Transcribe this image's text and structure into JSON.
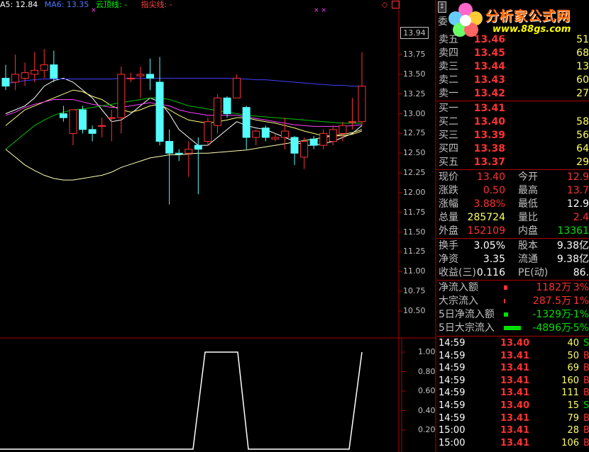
{
  "legend": {
    "ma5": "A5: 12.84",
    "ma6": "MA6: 13.35",
    "cloud": "云顶线: -",
    "tip": "指尖线: -",
    "marker1": "×",
    "marker2": "× ×",
    "marker3": "◇"
  },
  "colors": {
    "bg": "#000000",
    "up": "#ff3232",
    "down": "#54fcfc",
    "grid": "#b00000",
    "ma_white": "#ffffff",
    "ma_yellow": "#ffff80",
    "ma_magenta": "#ff40ff",
    "ma_green": "#00c000",
    "ma_blue": "#4040ff"
  },
  "price_axis": {
    "current_box": "13.94",
    "ticks": [
      "13.75",
      "13.50",
      "13.25",
      "13.00",
      "12.75",
      "12.50",
      "12.25",
      "12.00",
      "11.75",
      "11.50",
      "11.25",
      "11.00",
      "10.75",
      "10.50"
    ]
  },
  "indicator_axis": {
    "ticks": [
      "1.00",
      "0.80",
      "0.60",
      "0.40",
      "0.20"
    ]
  },
  "chart_data": {
    "type": "candlestick",
    "candles": [
      {
        "o": 13.45,
        "h": 13.62,
        "l": 13.3,
        "c": 13.35
      },
      {
        "o": 13.4,
        "h": 13.75,
        "l": 13.3,
        "c": 13.5
      },
      {
        "o": 13.45,
        "h": 13.65,
        "l": 13.35,
        "c": 13.52
      },
      {
        "o": 13.5,
        "h": 13.78,
        "l": 13.4,
        "c": 13.55
      },
      {
        "o": 13.55,
        "h": 13.82,
        "l": 13.45,
        "c": 13.62
      },
      {
        "o": 13.62,
        "h": 13.8,
        "l": 13.4,
        "c": 13.45
      },
      {
        "o": 13.0,
        "h": 13.1,
        "l": 12.9,
        "c": 12.95
      },
      {
        "o": 12.75,
        "h": 13.05,
        "l": 12.6,
        "c": 13.05
      },
      {
        "o": 13.05,
        "h": 13.1,
        "l": 12.75,
        "c": 12.8
      },
      {
        "o": 12.8,
        "h": 12.85,
        "l": 12.65,
        "c": 12.75
      },
      {
        "o": 12.85,
        "h": 12.95,
        "l": 12.7,
        "c": 12.85
      },
      {
        "o": 12.95,
        "h": 13.05,
        "l": 12.65,
        "c": 12.95
      },
      {
        "o": 12.95,
        "h": 13.6,
        "l": 12.75,
        "c": 13.5
      },
      {
        "o": 13.45,
        "h": 13.52,
        "l": 13.4,
        "c": 13.45
      },
      {
        "o": 13.48,
        "h": 13.6,
        "l": 13.2,
        "c": 13.5
      },
      {
        "o": 13.5,
        "h": 13.7,
        "l": 13.3,
        "c": 13.45
      },
      {
        "o": 13.4,
        "h": 13.72,
        "l": 12.6,
        "c": 12.65
      },
      {
        "o": 12.65,
        "h": 12.8,
        "l": 11.85,
        "c": 12.5
      },
      {
        "o": 12.5,
        "h": 12.55,
        "l": 12.4,
        "c": 12.49
      },
      {
        "o": 12.5,
        "h": 12.65,
        "l": 12.2,
        "c": 12.55
      },
      {
        "o": 12.6,
        "h": 12.7,
        "l": 11.98,
        "c": 12.55
      },
      {
        "o": 12.65,
        "h": 12.95,
        "l": 12.6,
        "c": 12.9
      },
      {
        "o": 12.85,
        "h": 13.25,
        "l": 12.75,
        "c": 13.2
      },
      {
        "o": 13.2,
        "h": 13.22,
        "l": 12.95,
        "c": 13.0
      },
      {
        "o": 13.2,
        "h": 13.5,
        "l": 13.2,
        "c": 13.45
      },
      {
        "o": 13.08,
        "h": 13.1,
        "l": 12.55,
        "c": 12.7
      },
      {
        "o": 12.7,
        "h": 12.8,
        "l": 12.6,
        "c": 12.78
      },
      {
        "o": 12.82,
        "h": 12.85,
        "l": 12.65,
        "c": 12.7
      },
      {
        "o": 12.68,
        "h": 12.75,
        "l": 12.65,
        "c": 12.7
      },
      {
        "o": 12.7,
        "h": 12.95,
        "l": 12.55,
        "c": 12.78
      },
      {
        "o": 12.7,
        "h": 12.72,
        "l": 12.35,
        "c": 12.5
      },
      {
        "o": 12.45,
        "h": 12.7,
        "l": 12.3,
        "c": 12.65
      },
      {
        "o": 12.68,
        "h": 12.72,
        "l": 12.55,
        "c": 12.6
      },
      {
        "o": 12.6,
        "h": 12.8,
        "l": 12.55,
        "c": 12.75
      },
      {
        "o": 12.65,
        "h": 12.85,
        "l": 12.6,
        "c": 12.8
      },
      {
        "o": 12.75,
        "h": 12.9,
        "l": 12.65,
        "c": 12.85
      },
      {
        "o": 12.9,
        "h": 13.2,
        "l": 12.8,
        "c": 12.9
      },
      {
        "o": 12.9,
        "h": 13.78,
        "l": 12.85,
        "c": 13.35
      }
    ],
    "ylim": [
      10.25,
      14.0
    ],
    "ma_lines": [
      {
        "name": "ma-white",
        "color": "#ffffff",
        "values": [
          13.0,
          13.05,
          13.1,
          13.2,
          13.35,
          13.42,
          13.45,
          13.4,
          13.3,
          13.2,
          13.05,
          12.9,
          12.92,
          13.0,
          13.1,
          13.2,
          13.15,
          13.0,
          12.8,
          12.7,
          12.6,
          12.6,
          12.7,
          12.8,
          12.9,
          12.85,
          12.82,
          12.8,
          12.75,
          12.7,
          12.65,
          12.6,
          12.6,
          12.62,
          12.65,
          12.7,
          12.75,
          12.85
        ]
      },
      {
        "name": "ma-yellow",
        "color": "#ffff80",
        "values": [
          12.85,
          12.95,
          13.05,
          13.1,
          13.15,
          13.2,
          13.25,
          13.3,
          13.28,
          13.22,
          13.18,
          13.1,
          13.05,
          13.02,
          13.05,
          13.1,
          13.12,
          13.05,
          12.98,
          12.92,
          12.9,
          12.88,
          12.9,
          12.92,
          12.95,
          12.95,
          12.92,
          12.9,
          12.88,
          12.85,
          12.82,
          12.78,
          12.75,
          12.72,
          12.72,
          12.72,
          12.74,
          12.78
        ]
      },
      {
        "name": "ma-magenta",
        "color": "#ff40ff",
        "values": [
          12.98,
          13.02,
          13.08,
          13.12,
          13.15,
          13.18,
          13.18,
          13.18,
          13.15,
          13.12,
          13.1,
          13.08,
          13.08,
          13.1,
          13.12,
          13.14,
          13.12,
          13.1,
          13.05,
          13.02,
          13.0,
          12.98,
          12.98,
          12.98,
          12.98,
          12.96,
          12.94,
          12.92,
          12.9,
          12.88,
          12.86,
          12.85,
          12.84,
          12.84,
          12.84,
          12.84,
          12.85,
          12.86
        ]
      },
      {
        "name": "ma-green",
        "color": "#00c000",
        "values": [
          12.55,
          12.65,
          12.75,
          12.85,
          12.92,
          12.98,
          13.02,
          13.05,
          13.06,
          13.08,
          13.1,
          13.12,
          13.14,
          13.16,
          13.18,
          13.2,
          13.2,
          13.18,
          13.14,
          13.1,
          13.08,
          13.06,
          13.04,
          13.02,
          13.0,
          12.98,
          12.97,
          12.96,
          12.95,
          12.94,
          12.93,
          12.92,
          12.91,
          12.9,
          12.89,
          12.88,
          12.88,
          12.88
        ]
      },
      {
        "name": "ma-blue",
        "color": "#4040ff",
        "values": [
          13.38,
          13.4,
          13.42,
          13.43,
          13.44,
          13.44,
          13.44,
          13.44,
          13.44,
          13.44,
          13.44,
          13.44,
          13.45,
          13.45,
          13.45,
          13.45,
          13.45,
          13.45,
          13.45,
          13.45,
          13.45,
          13.45,
          13.45,
          13.45,
          13.44,
          13.44,
          13.43,
          13.43,
          13.42,
          13.41,
          13.4,
          13.39,
          13.38,
          13.37,
          13.36,
          13.36,
          13.35,
          13.35
        ]
      },
      {
        "name": "ma-lower",
        "color": "#ffffb0",
        "values": [
          12.55,
          12.45,
          12.35,
          12.28,
          12.22,
          12.18,
          12.16,
          12.16,
          12.18,
          12.2,
          12.22,
          12.26,
          12.32,
          12.36,
          12.4,
          12.44,
          12.46,
          12.48,
          12.48,
          12.49,
          12.5,
          12.5,
          12.51,
          12.52,
          12.53,
          12.54,
          12.56,
          12.58,
          12.6,
          12.62,
          12.64,
          12.66,
          12.68,
          12.7,
          12.72,
          12.74,
          12.76,
          12.8
        ]
      }
    ],
    "indicator": [
      0,
      0,
      0,
      0,
      0,
      0,
      0,
      0,
      0,
      0,
      0,
      0,
      0,
      0,
      0,
      0,
      0,
      0,
      0,
      0,
      0,
      0,
      0,
      0,
      0,
      1,
      1,
      1,
      1,
      0,
      0,
      0,
      0,
      0,
      0,
      0,
      0,
      0,
      0,
      0,
      0,
      0,
      0,
      0,
      0,
      1
    ]
  },
  "panel": {
    "logo_text": "分析家公式网",
    "logo_url": "www.88gs.com",
    "top_label": "委",
    "sell": [
      {
        "label": "卖五",
        "price": "13.46",
        "vol": "51"
      },
      {
        "label": "卖四",
        "price": "13.45",
        "vol": "68"
      },
      {
        "label": "卖三",
        "price": "13.44",
        "vol": "13"
      },
      {
        "label": "卖二",
        "price": "13.43",
        "vol": "60"
      },
      {
        "label": "卖一",
        "price": "13.42",
        "vol": "27"
      }
    ],
    "buy": [
      {
        "label": "买一",
        "price": "13.41",
        "vol": ""
      },
      {
        "label": "买二",
        "price": "13.40",
        "vol": "58"
      },
      {
        "label": "买三",
        "price": "13.39",
        "vol": "56"
      },
      {
        "label": "买四",
        "price": "13.38",
        "vol": "64"
      },
      {
        "label": "买五",
        "price": "13.37",
        "vol": "29"
      }
    ],
    "stats1": [
      {
        "l1": "现价",
        "v1": "13.40",
        "l2": "今开",
        "v2": "12.9"
      },
      {
        "l1": "涨跌",
        "v1": "0.50",
        "l2": "最高",
        "v2": "13.7"
      },
      {
        "l1": "涨幅",
        "v1": "3.88%",
        "l2": "最低",
        "v2": "12.9"
      },
      {
        "l1": "总量",
        "v1": "285724",
        "l2": "量比",
        "v2": "2.4"
      },
      {
        "l1": "外盘",
        "v1": "152109",
        "l2": "内盘",
        "v2": "13361"
      }
    ],
    "stats2": [
      {
        "l1": "换手",
        "v1": "3.05%",
        "l2": "股本",
        "v2": "9.38亿"
      },
      {
        "l1": "净资",
        "v1": "3.35",
        "l2": "流通",
        "v2": "9.38亿"
      },
      {
        "l1": "收益(三)",
        "v1": "0.116",
        "l2": "PE(动)",
        "v2": "86."
      }
    ],
    "flows": [
      {
        "label": "净流入额",
        "value": "1182万",
        "pct": "3%"
      },
      {
        "label": "大宗流入",
        "value": "287.5万",
        "pct": "1%"
      },
      {
        "label": "5日净流入额",
        "value": "-1329万",
        "pct": "-1%"
      },
      {
        "label": "5日大宗流入",
        "value": "-4896万",
        "pct": "-5%"
      }
    ],
    "ticks": [
      {
        "time": "14:59",
        "price": "13.40",
        "vol": "40",
        "flag": "S"
      },
      {
        "time": "14:59",
        "price": "13.41",
        "vol": "50",
        "flag": "B"
      },
      {
        "time": "14:59",
        "price": "13.41",
        "vol": "69",
        "flag": "B"
      },
      {
        "time": "14:59",
        "price": "13.41",
        "vol": "160",
        "flag": "B"
      },
      {
        "time": "14:59",
        "price": "13.41",
        "vol": "111",
        "flag": "B"
      },
      {
        "time": "14:59",
        "price": "13.40",
        "vol": "15",
        "flag": "S"
      },
      {
        "time": "14:59",
        "price": "13.41",
        "vol": "79",
        "flag": "B"
      },
      {
        "time": "15:00",
        "price": "13.41",
        "vol": "28",
        "flag": "B"
      },
      {
        "time": "15:00",
        "price": "13.41",
        "vol": "106",
        "flag": "B"
      }
    ]
  }
}
